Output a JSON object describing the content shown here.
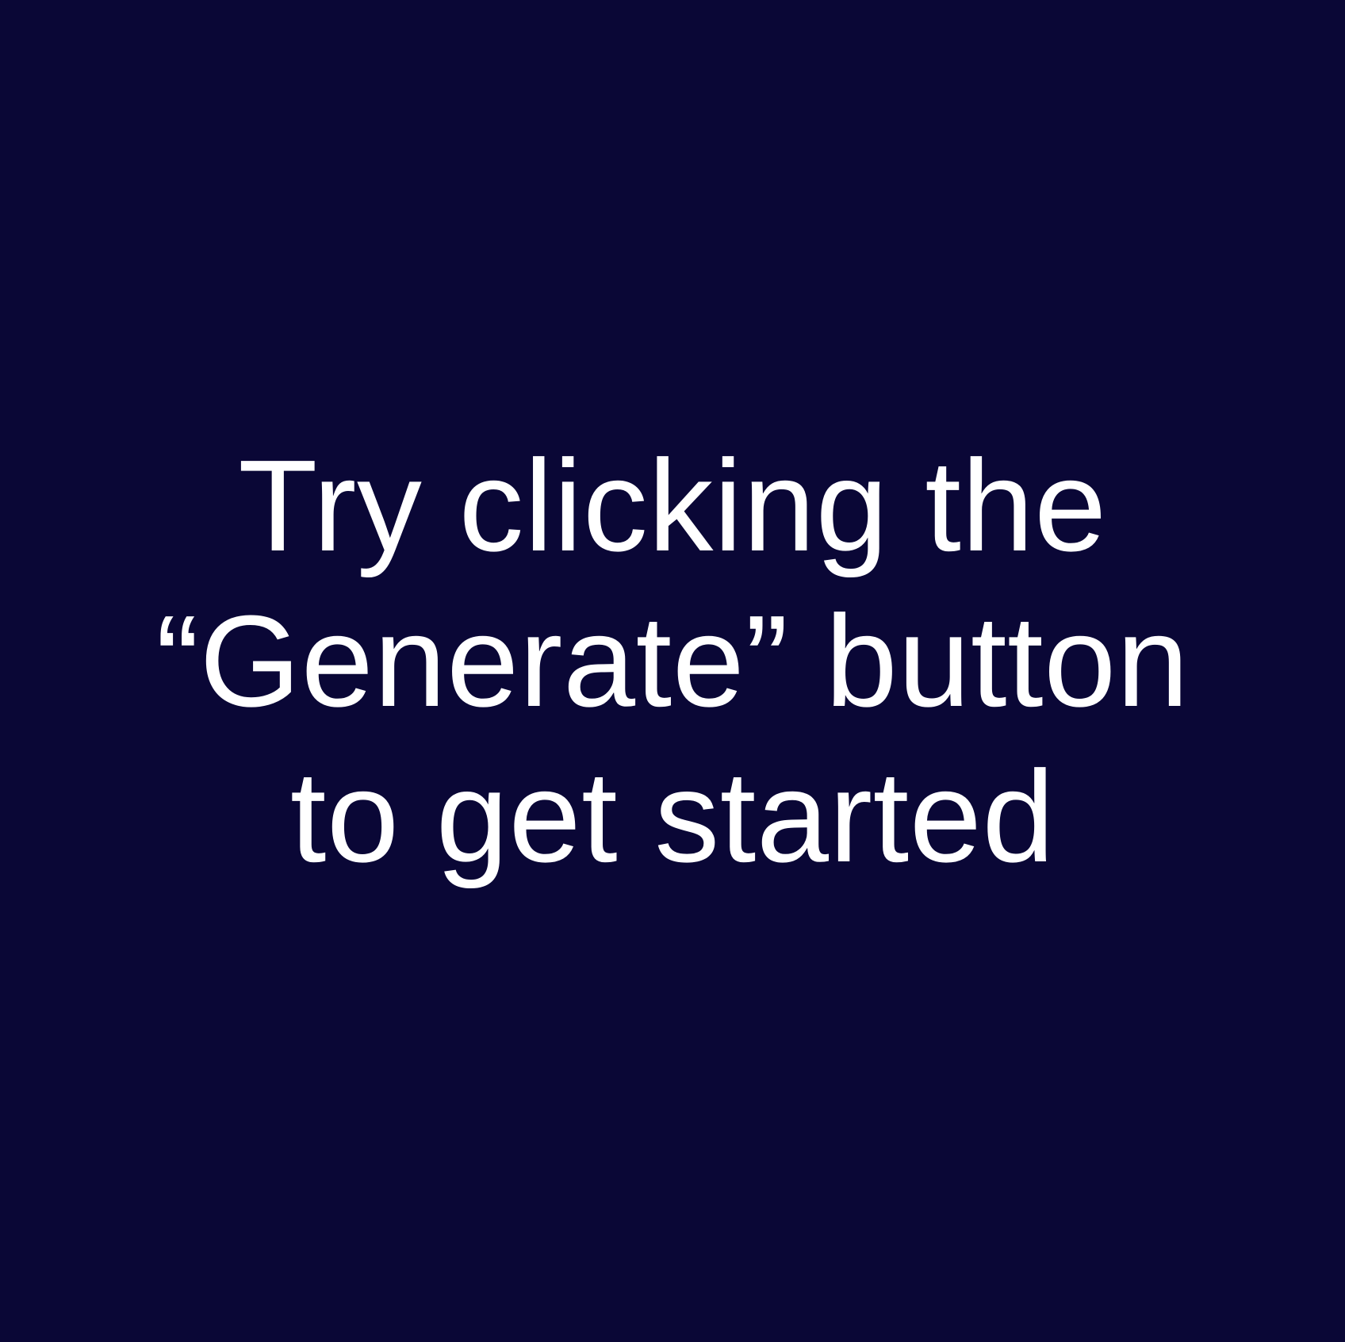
{
  "empty_state": {
    "background_color": "#0a0736",
    "text_color": "#ffffff",
    "lines": [
      "Try clicking the",
      "“Generate” button",
      "to get started"
    ]
  }
}
